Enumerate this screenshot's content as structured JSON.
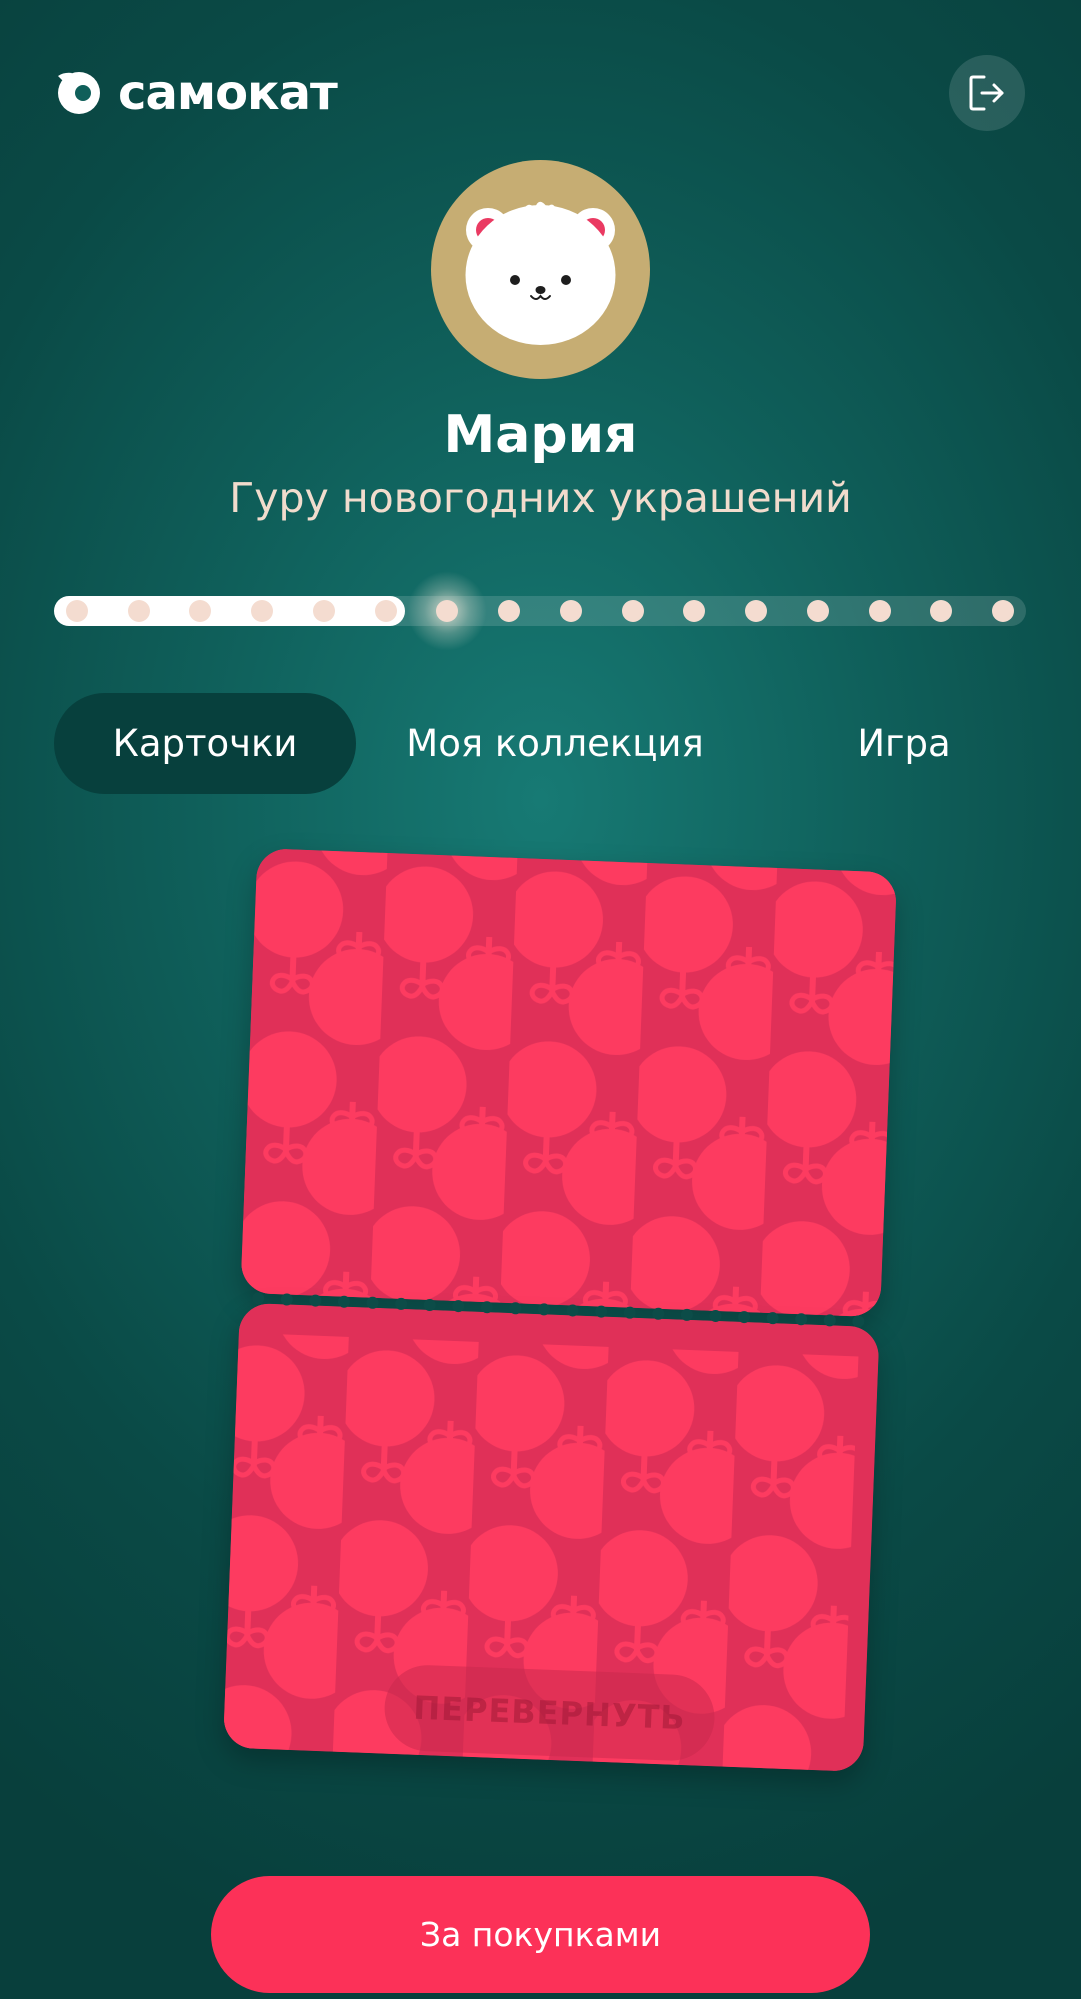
{
  "header": {
    "logo_text": "самокат",
    "logout_icon": "logout-icon"
  },
  "profile": {
    "name": "Мария",
    "title": "Гуру новогодних украшений",
    "avatar_icon": "bear-avatar"
  },
  "progress": {
    "total_steps": 16,
    "completed_steps": 6,
    "current_step": 7
  },
  "tabs": [
    {
      "label": "Карточки",
      "active": true
    },
    {
      "label": "Моя коллекция",
      "active": false
    },
    {
      "label": "Игра",
      "active": false
    }
  ],
  "card": {
    "flip_label": "ПЕРЕВЕРНУТЬ",
    "pattern_icon": "christmas-ornament-pattern"
  },
  "cta": {
    "label": "За покупками"
  },
  "colors": {
    "background": "#0f5f5a",
    "accent": "#fc3158",
    "card": "#e03058",
    "ornament": "#fd3b60",
    "avatar_bg": "#c6ad73",
    "active_tab": "#07403d"
  }
}
